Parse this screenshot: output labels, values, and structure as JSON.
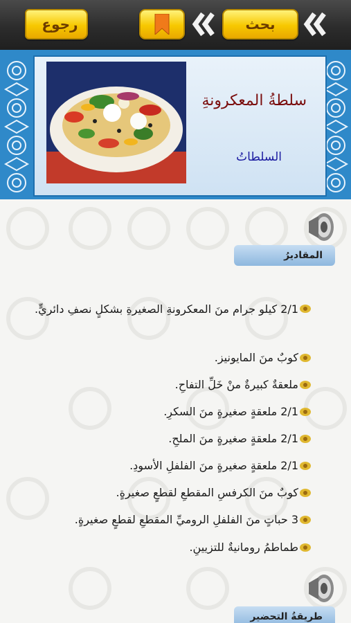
{
  "toolbar": {
    "back_label": "رجوع",
    "search_label": "بحث",
    "bookmark_icon": "bookmark-icon",
    "prev_icon": "double-chevron-left-icon",
    "next_icon": "double-chevron-left-icon"
  },
  "recipe": {
    "title": "سلطةُ المعكرونةِ",
    "category": "السلطاتُ"
  },
  "sections": {
    "ingredients_label": "المقاديرُ",
    "next_label": "طريقةُ التحضير"
  },
  "ingredients": [
    "2/1 كيلو جرام منَ المعكرونةِ الصغيرةِ بشكلٍ نصفِ دائريٍّ.",
    "كوبٌ منَ المايونيز.",
    "ملعقةٌ كبيرةٌ منْ خَلِّ التفاحِ.",
    "2/1 ملعقةٍ صغيرةٍ منَ السكرِ.",
    "2/1 ملعقةٍ صغيرةٍ منَ الملحِ.",
    "2/1 ملعقةٍ صغيرةٍ منَ الفلفلِ الأسودِ.",
    "كوبٌ منَ الكرفسِ المقطعِ لقطعٍ صغيرةٍ.",
    "3 حباتٍ منَ الفلفلِ الروميِّ المقطعِ لقطعٍ صغيرةٍ.",
    "طماطمُ رومانيةٌ للتزيينِ."
  ],
  "colors": {
    "topbar": "#2c2c2c",
    "button_yellow": "#f7c800",
    "header_blue": "#2f89c9",
    "title_red": "#7a0d0d",
    "category_blue": "#1a1aa0"
  }
}
